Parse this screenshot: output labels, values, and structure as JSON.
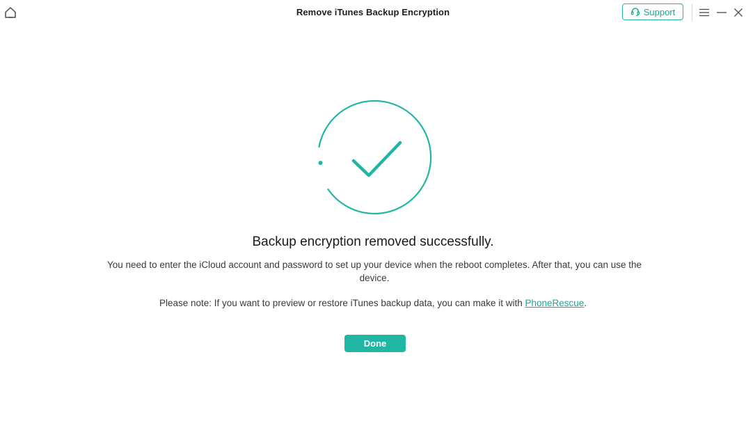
{
  "window": {
    "title": "Remove iTunes Backup Encryption",
    "support_label": "Support"
  },
  "icons": {
    "home": "home-icon",
    "support": "headset-icon",
    "menu": "menu-icon",
    "minimize": "minimize-icon",
    "close": "close-icon",
    "success": "check-circle-icon"
  },
  "colors": {
    "accent": "#1fb6a4",
    "link": "#17a898"
  },
  "main": {
    "headline": "Backup encryption removed successfully.",
    "message": "You need to enter the iCloud account and password to set up your device when the reboot completes. After that, you can use the device.",
    "note_prefix": "Please note: If you want to preview or restore iTunes backup data, you can make it with ",
    "note_link": "PhoneRescue",
    "note_suffix": ".",
    "done_label": "Done"
  }
}
